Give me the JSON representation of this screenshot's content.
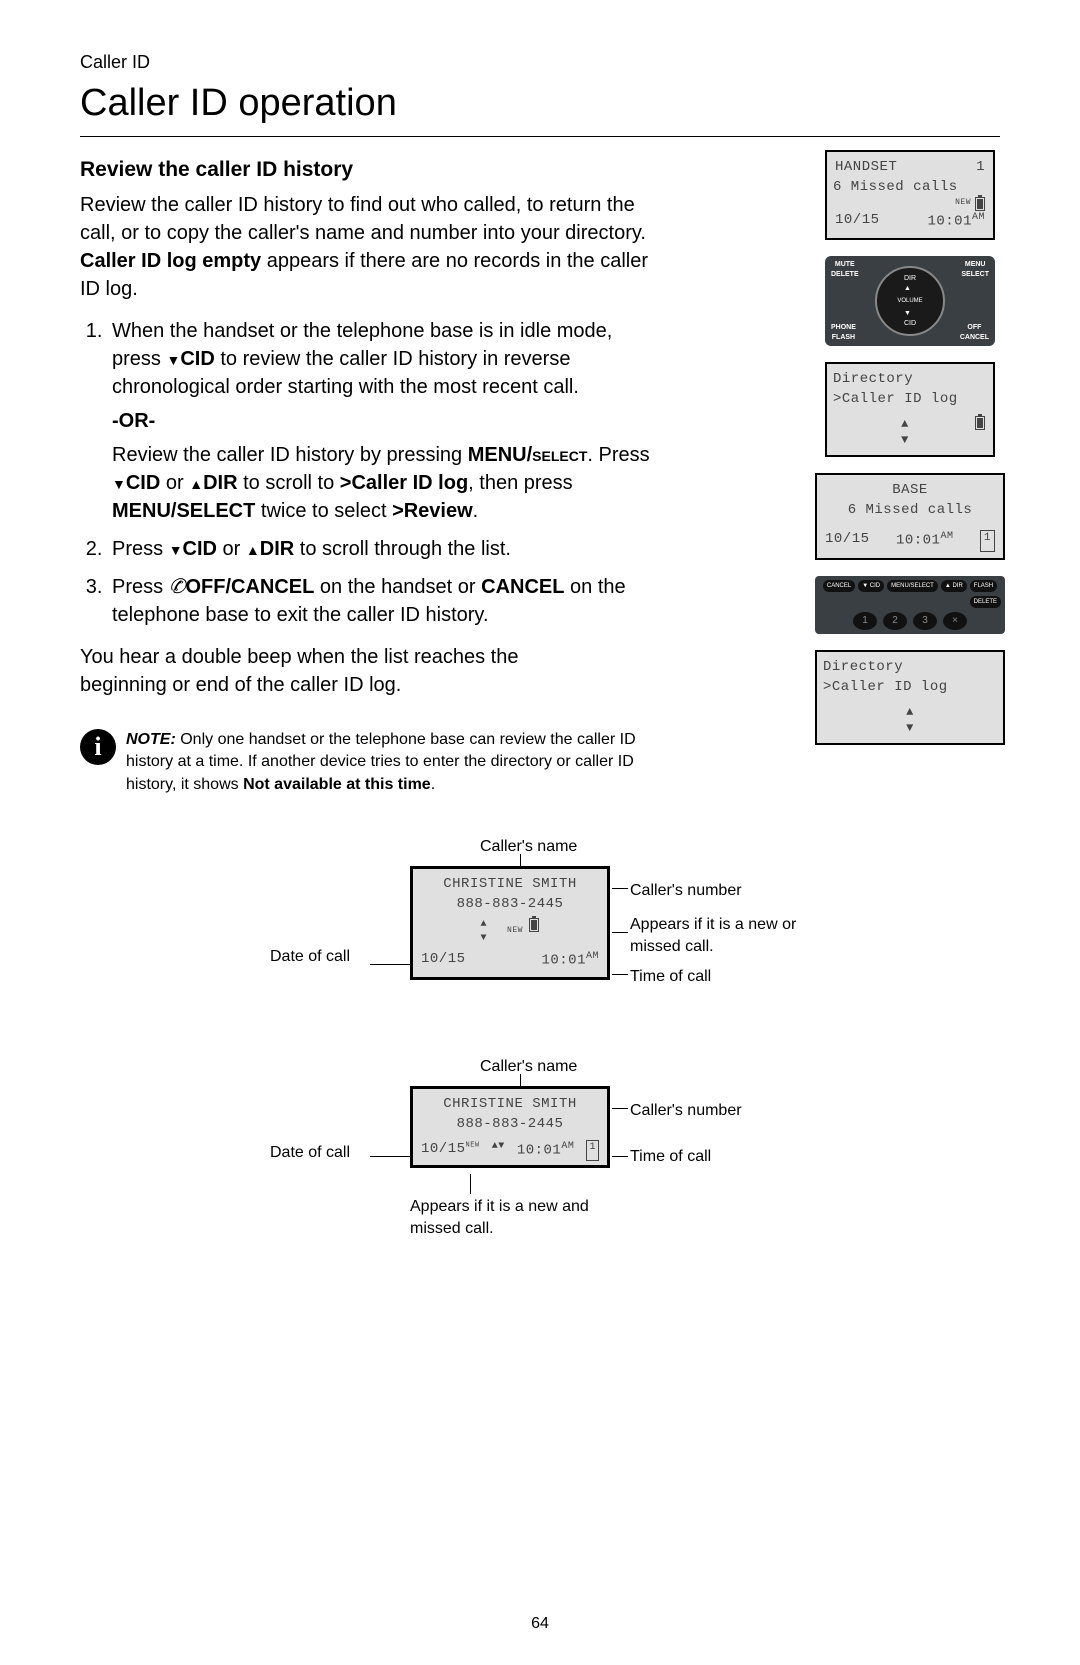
{
  "header": {
    "small": "Caller ID",
    "large": "Caller ID operation"
  },
  "section_title": "Review the caller ID history",
  "intro": {
    "p1a": "Review the caller ID history to find out who called, to return the call, or to copy the caller's name and number into your directory. ",
    "p1b": "Caller ID log empty",
    "p1c": " appears if there are no records in the caller ID log."
  },
  "step1": {
    "a": "When the handset or the telephone base is in idle mode, press ",
    "cid": "CID",
    "b": " to review the caller ID history in reverse chronological order starting with the most recent call."
  },
  "or": "-OR-",
  "step1b": {
    "a": "Review the caller ID history by pressing ",
    "menu": "MENU/",
    "select": "select",
    "b": ". Press ",
    "cid": "CID",
    "c": " or ",
    "dir": "DIR",
    "d": " to scroll to ",
    "cidlog": ">Caller ID log",
    "e": ", then press ",
    "ms": "MENU/SELECT",
    "f": " twice to select ",
    "rev": ">Review",
    "g": "."
  },
  "step2": {
    "a": "Press ",
    "cid": "CID",
    "b": " or ",
    "dir": "DIR",
    "c": " to scroll through the list."
  },
  "step3": {
    "a": "Press ",
    "off": "OFF/CANCEL",
    "b": " on the handset or ",
    "cancel": "CANCEL",
    "c": " on the telephone base to exit the caller ID history."
  },
  "closing": "You hear a double beep when the list reaches the beginning or end of the caller ID log.",
  "note": {
    "label": "NOTE:",
    "a": " Only one handset or the telephone base can review the caller ID history at a time. If another device tries to enter the directory or caller ID history, it shows ",
    "b": "Not available at this time",
    "c": "."
  },
  "lcd1": {
    "l1a": "HANDSET",
    "l1b": "1",
    "l2": "6 Missed calls",
    "new": "NEW",
    "date": "10/15",
    "time": "10:01",
    "ampm": "AM"
  },
  "keypad": {
    "tl1": "MUTE",
    "tl2": "DELETE",
    "tr1": "MENU",
    "tr2": "SELECT",
    "bl1": "PHONE",
    "bl2": "FLASH",
    "br1": "OFF",
    "br2": "CANCEL",
    "dir": "DIR",
    "vol": "VOLUME",
    "cid": "CID"
  },
  "lcd2": {
    "l1": "Directory",
    "l2": ">Caller ID log"
  },
  "lcd3": {
    "l1": "BASE",
    "l2": "6 Missed calls",
    "date": "10/15",
    "time": "10:01",
    "ampm": "AM",
    "msg": "1"
  },
  "basebar": {
    "b1": "CANCEL",
    "b2": "▼ CID",
    "b3": "MENU/SELECT",
    "b4": "▲ DIR",
    "b5": "FLASH",
    "b6": "DELETE"
  },
  "lcd4": {
    "l1": "Directory",
    "l2": ">Caller ID log"
  },
  "diag": {
    "name_label": "Caller's name",
    "number_label": "Caller's number",
    "date_label": "Date of call",
    "time_label": "Time of call",
    "new_label1": "Appears if it is a new or missed call.",
    "new_label2": "Appears if it is a new and missed call.",
    "name": "CHRISTINE SMITH",
    "number": "888-883-2445",
    "date": "10/15",
    "time": "10:01",
    "ampm": "AM",
    "new": "NEW",
    "msg": "1"
  },
  "page": "64"
}
